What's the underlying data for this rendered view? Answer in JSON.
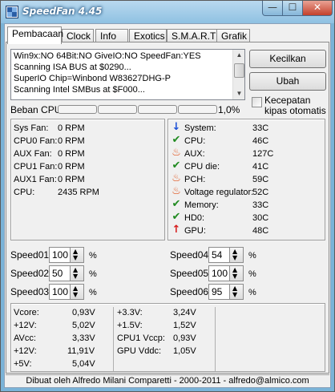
{
  "window": {
    "title": "SpeedFan 4.45",
    "min_glyph": "—",
    "max_glyph": "☐",
    "close_glyph": "✕"
  },
  "tabs": [
    {
      "label": "Pembacaan",
      "active": true
    },
    {
      "label": "Clock",
      "active": false
    },
    {
      "label": "Info",
      "active": false
    },
    {
      "label": "Exotics",
      "active": false
    },
    {
      "label": "S.M.A.R.T",
      "active": false
    },
    {
      "label": "Grafik",
      "active": false
    }
  ],
  "log": {
    "lines": [
      "Win9x:NO  64Bit:NO  GiveIO:NO  SpeedFan:YES",
      "Scanning ISA BUS at $0290...",
      "SuperIO Chip=Winbond W83627DHG-P",
      "Scanning Intel SMBus at $F000..."
    ]
  },
  "buttons": {
    "minimize": "Kecilkan",
    "configure": "Ubah"
  },
  "auto_fan_speed": {
    "label": "Kecepatan kipas otomatis",
    "checked": false
  },
  "cpu_usage": {
    "label": "Beban CPU",
    "value": "1,0%"
  },
  "fans": [
    {
      "label": "Sys Fan:",
      "value": "0 RPM"
    },
    {
      "label": "CPU0 Fan:",
      "value": "0 RPM"
    },
    {
      "label": "AUX Fan:",
      "value": "0 RPM"
    },
    {
      "label": "CPU1 Fan:",
      "value": "0 RPM"
    },
    {
      "label": "AUX1 Fan:",
      "value": "0 RPM"
    },
    {
      "label": "CPU:",
      "value": "2435 RPM"
    }
  ],
  "temps": [
    {
      "label": "System:",
      "value": "33C",
      "icon": "arrow-down-icon"
    },
    {
      "label": "CPU:",
      "value": "46C",
      "icon": "check-icon"
    },
    {
      "label": "AUX:",
      "value": "127C",
      "icon": "flame-icon"
    },
    {
      "label": "CPU die:",
      "value": "41C",
      "icon": "check-icon"
    },
    {
      "label": "PCH:",
      "value": "59C",
      "icon": "flame-icon"
    },
    {
      "label": "Voltage regulator:",
      "value": "52C",
      "icon": "flame-icon"
    },
    {
      "label": "Memory:",
      "value": "33C",
      "icon": "check-icon"
    },
    {
      "label": "HD0:",
      "value": "30C",
      "icon": "check-icon"
    },
    {
      "label": "GPU:",
      "value": "48C",
      "icon": "arrow-up-icon"
    }
  ],
  "speeds_left": [
    {
      "label": "Speed01:",
      "value": "100",
      "unit": "%"
    },
    {
      "label": "Speed02:",
      "value": "50",
      "unit": "%"
    },
    {
      "label": "Speed03:",
      "value": "100",
      "unit": "%"
    }
  ],
  "speeds_right": [
    {
      "label": "Speed04:",
      "value": "54",
      "unit": "%"
    },
    {
      "label": "Speed05:",
      "value": "100",
      "unit": "%"
    },
    {
      "label": "Speed06:",
      "value": "95",
      "unit": "%"
    }
  ],
  "voltages_col1": [
    {
      "label": "Vcore:",
      "value": "0,93V"
    },
    {
      "label": "+12V:",
      "value": "5,02V"
    },
    {
      "label": "AVcc:",
      "value": "3,33V"
    },
    {
      "label": "+12V:",
      "value": "11,91V"
    },
    {
      "label": "+5V:",
      "value": "5,04V"
    }
  ],
  "voltages_col2": [
    {
      "label": "+3.3V:",
      "value": "3,24V"
    },
    {
      "label": "+1.5V:",
      "value": "1,52V"
    },
    {
      "label": "CPU1 Vccp:",
      "value": "0,93V"
    },
    {
      "label": "GPU Vddc:",
      "value": "1,05V"
    }
  ],
  "footer": {
    "text": "Dibuat oleh Alfredo Milani Comparetti - 2000-2011 - alfredo@almico.com"
  },
  "colors": {
    "check": "#1f8a1f",
    "flame": "#e0521b",
    "arrow_down": "#1a4fd6",
    "arrow_up": "#d61a1a"
  }
}
